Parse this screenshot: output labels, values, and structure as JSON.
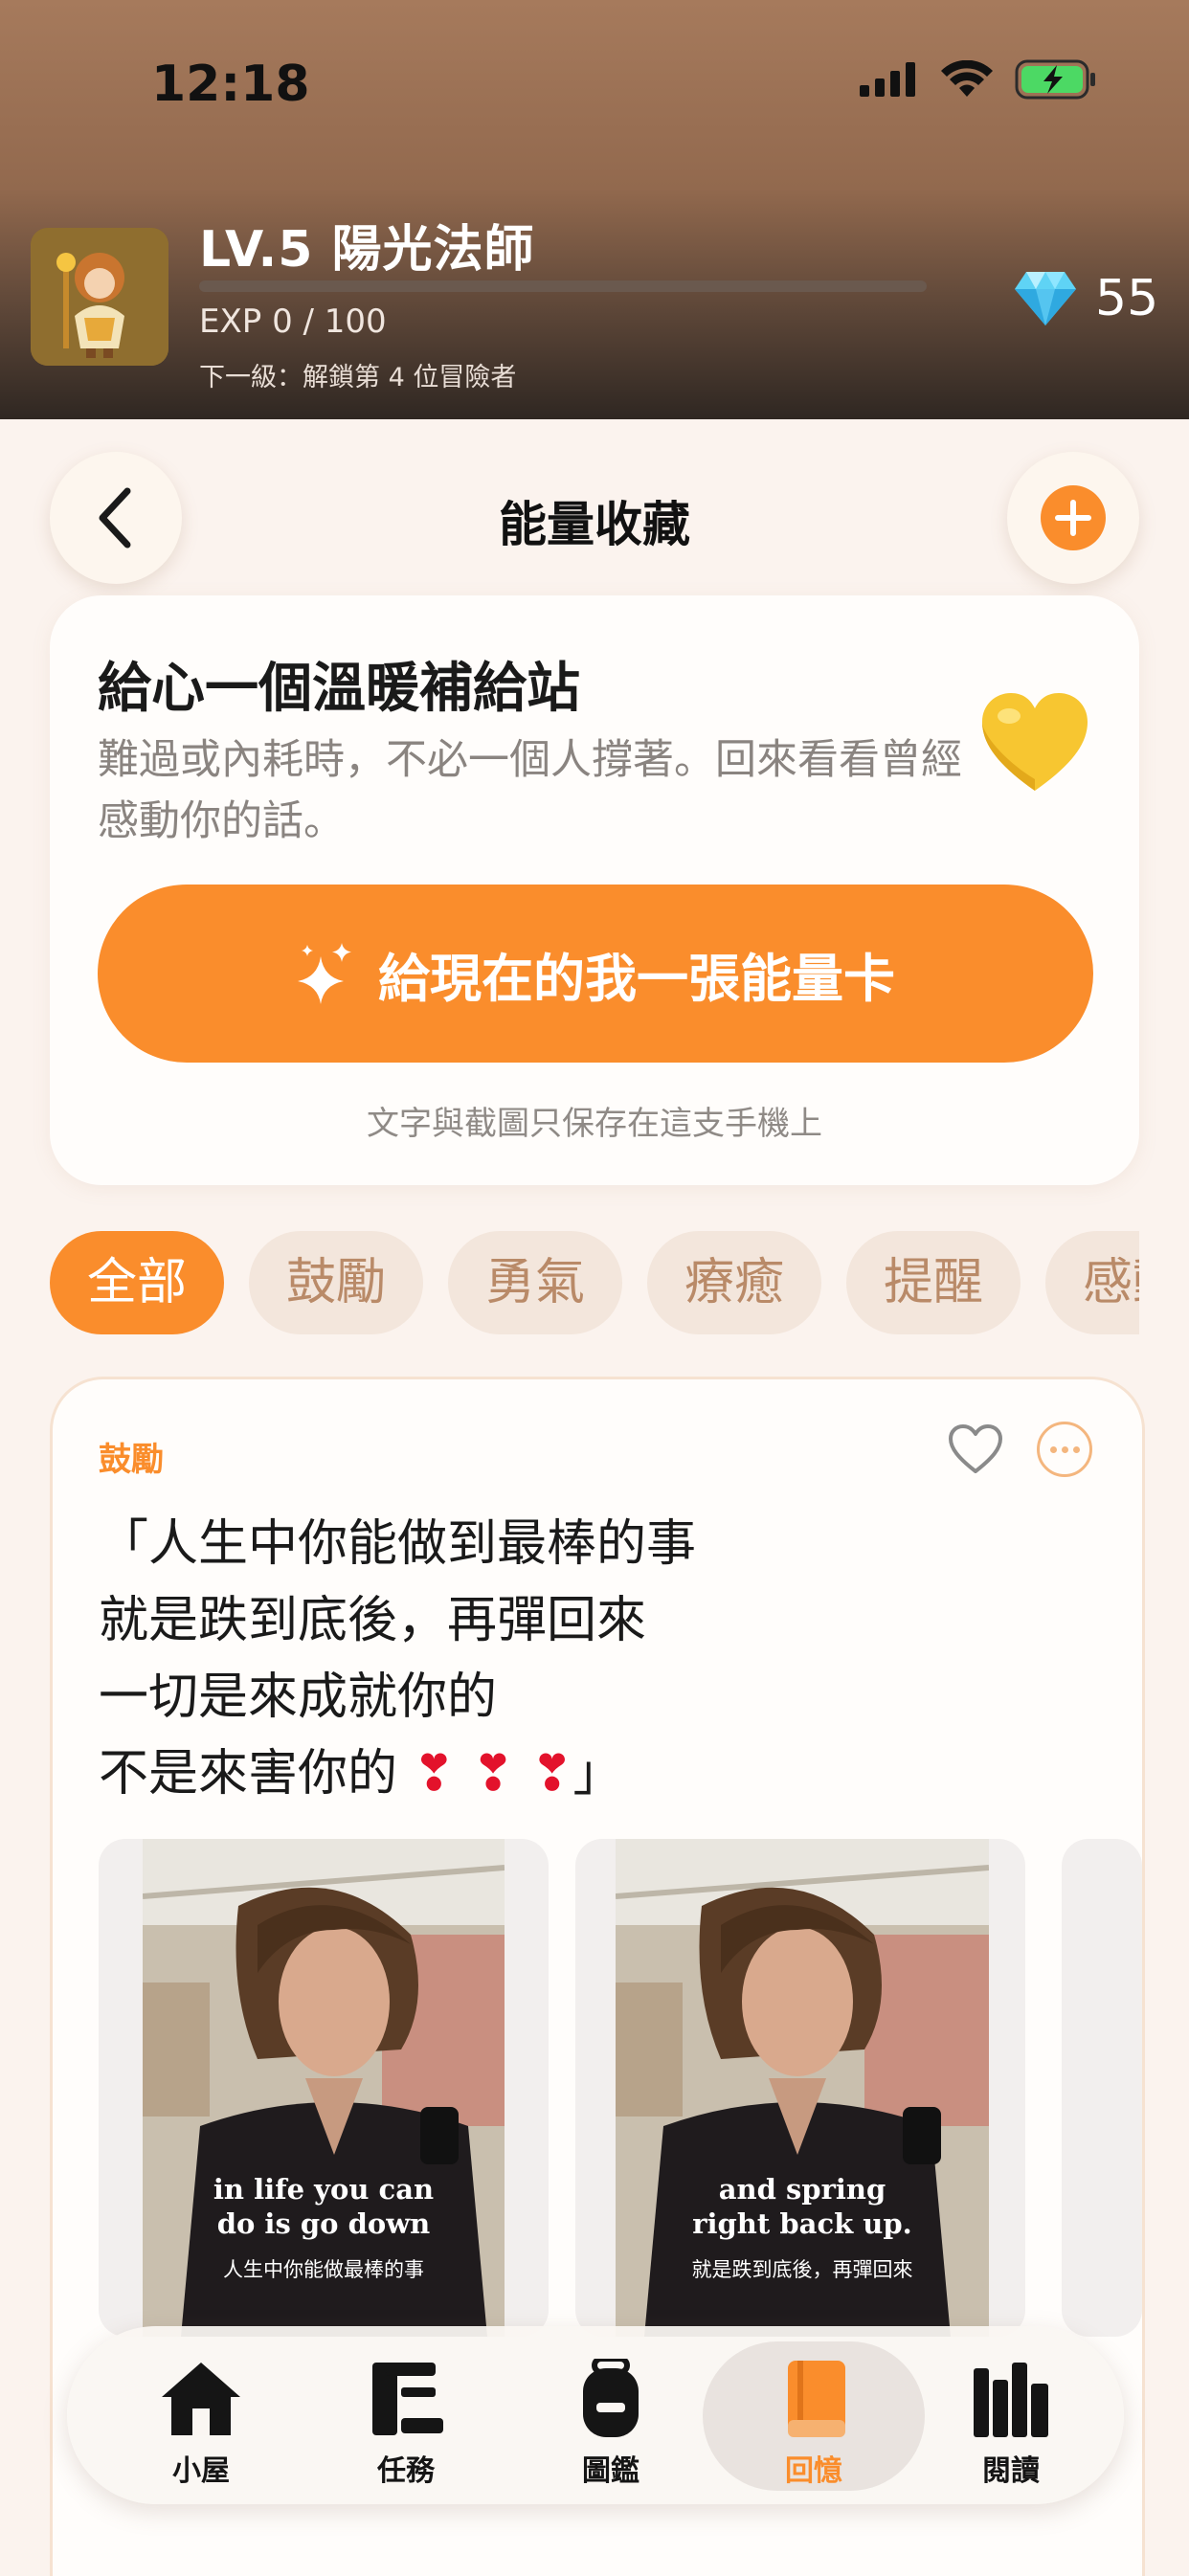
{
  "status_bar": {
    "time": "12:18"
  },
  "profile": {
    "level_title": "LV.5  陽光法師",
    "exp_text": "EXP 0 / 100",
    "exp_progress": 0,
    "next_level_text": "下一級：解鎖第 4 位冒險者",
    "gems": "55"
  },
  "nav": {
    "title": "能量收藏"
  },
  "hero": {
    "title": "給心一個溫暖補給站",
    "description": "難過或內耗時，不必一個人撐著。回來看看曾經感動你的話。",
    "cta_label": "給現在的我一張能量卡",
    "privacy_note": "文字與截圖只保存在這支手機上"
  },
  "filters": [
    "全部",
    "鼓勵",
    "勇氣",
    "療癒",
    "提醒",
    "感動"
  ],
  "active_filter": "全部",
  "quote_card": {
    "tag": "鼓勵",
    "lines": [
      "「人生中你能做到最棒的事",
      "就是跌到底後，再彈回來",
      "一切是來成就你的",
      "不是來害你的"
    ],
    "last_line_emoji": "❣ ❣ ❣",
    "closing": "」",
    "screenshots": [
      {
        "subtitle_en_1": "in life you can",
        "subtitle_en_2": "do is go down",
        "subtitle_zh": "人生中你能做最棒的事"
      },
      {
        "subtitle_en_1": "and spring",
        "subtitle_en_2": "right back up.",
        "subtitle_zh": "就是跌到底後，再彈回來"
      }
    ]
  },
  "tabbar": {
    "items": [
      {
        "label": "小屋",
        "icon": "house-icon"
      },
      {
        "label": "任務",
        "icon": "scroll-icon"
      },
      {
        "label": "圖鑑",
        "icon": "backpack-icon"
      },
      {
        "label": "回憶",
        "icon": "book-icon"
      },
      {
        "label": "閱讀",
        "icon": "books-icon"
      }
    ],
    "active": "回憶"
  },
  "colors": {
    "accent": "#fa8d2c",
    "chip_bg": "#f3e6dc",
    "chip_text": "#b98a68",
    "page_bg": "#fbf3ee"
  }
}
